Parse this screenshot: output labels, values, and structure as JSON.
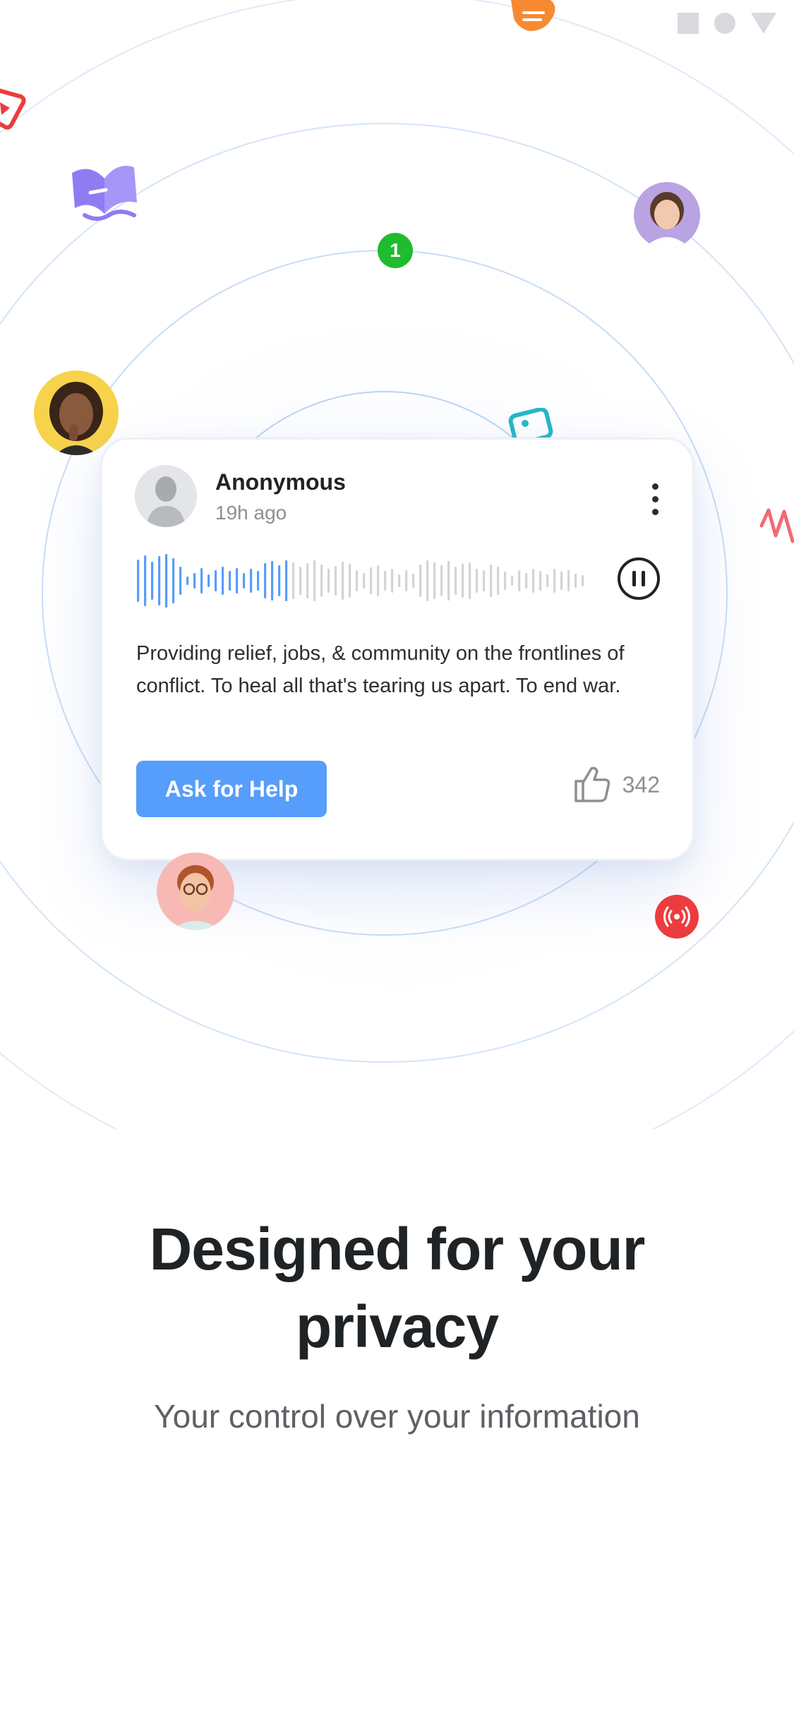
{
  "status_bar": {
    "icons": [
      "square-icon",
      "circle-icon",
      "triangle-icon"
    ]
  },
  "floating_badge": {
    "count": "1"
  },
  "post": {
    "author": "Anonymous",
    "time": "19h ago",
    "audio": {
      "progress": 0.34
    },
    "body": "Providing relief, jobs, & community on the frontlines of conflict. To heal all that's tearing us apart. To end war.",
    "cta_label": "Ask for Help",
    "likes": "342"
  },
  "onboarding": {
    "title_line1": "Designed for your",
    "title_line2": "privacy",
    "subtitle": "Your control over your information"
  },
  "colors": {
    "accent": "#579dfb",
    "badge_green": "#1ebc2e",
    "red_icon": "#ec3c3f",
    "text_dark": "#1f2326"
  }
}
